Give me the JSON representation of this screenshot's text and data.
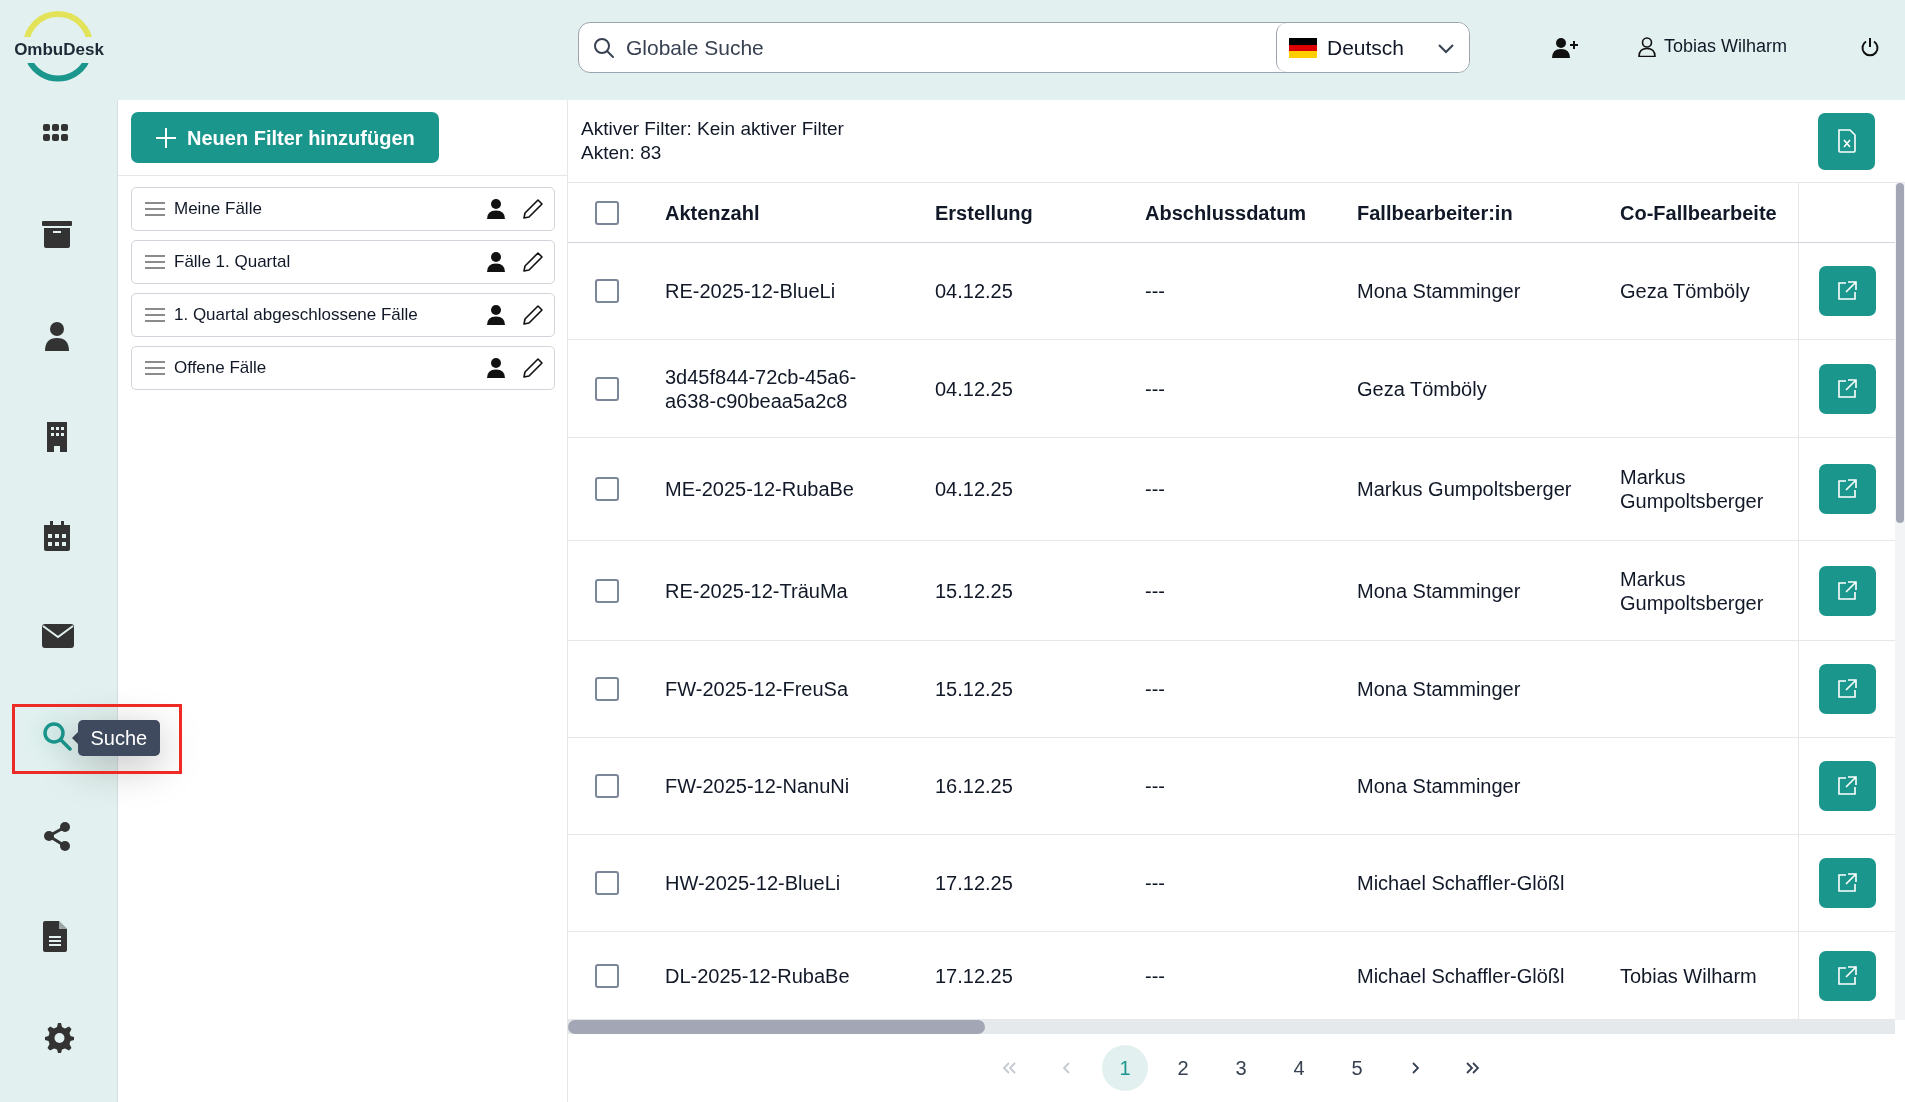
{
  "logo": {
    "text": "OmbuDesk"
  },
  "search": {
    "placeholder": "Globale Suche"
  },
  "language": {
    "label": "Deutsch"
  },
  "user": {
    "name": "Tobias Wilharm"
  },
  "nav": [
    {
      "kind": "apps",
      "selected": false,
      "highlighted": false
    },
    {
      "kind": "archive",
      "selected": false,
      "highlighted": false
    },
    {
      "kind": "person",
      "selected": false,
      "highlighted": false
    },
    {
      "kind": "building",
      "selected": false,
      "highlighted": false
    },
    {
      "kind": "calendar",
      "selected": false,
      "highlighted": false
    },
    {
      "kind": "mail",
      "selected": false,
      "highlighted": false
    },
    {
      "kind": "search",
      "selected": true,
      "highlighted": true,
      "tooltip": "Suche"
    },
    {
      "kind": "share",
      "selected": false,
      "highlighted": false
    },
    {
      "kind": "document",
      "selected": false,
      "highlighted": false
    },
    {
      "kind": "settings",
      "selected": false,
      "highlighted": false
    }
  ],
  "filter_panel": {
    "add_button": "Neuen Filter hinzufügen",
    "filters": [
      {
        "label": "Meine Fälle"
      },
      {
        "label": "Fälle 1. Quartal"
      },
      {
        "label": "1. Quartal abgeschlossene Fälle"
      },
      {
        "label": "Offene Fälle"
      }
    ]
  },
  "table_info": {
    "active_filter": "Aktiver Filter: Kein aktiver Filter",
    "count": "Akten: 83"
  },
  "table": {
    "select_all_checked": false,
    "columns": [
      "Aktenzahl",
      "Erstellung",
      "Abschlussdatum",
      "Fallbearbeiter:in",
      "Co-Fallbearbeite"
    ],
    "rows": [
      {
        "checked": false,
        "cells": [
          "RE-2025-12-BlueLi",
          "04.12.25",
          "---",
          "Mona Stamminger",
          "Geza Tömböly"
        ]
      },
      {
        "checked": false,
        "cells": [
          "3d45f844-72cb-45a6-a638-c90beaa5a2c8",
          "04.12.25",
          "---",
          "Geza Tömböly",
          ""
        ]
      },
      {
        "checked": false,
        "cells": [
          "ME-2025-12-RubaBe",
          "04.12.25",
          "---",
          "Markus Gumpoltsberger",
          "Markus Gumpoltsberger"
        ]
      },
      {
        "checked": false,
        "cells": [
          "RE-2025-12-TräuMa",
          "15.12.25",
          "---",
          "Mona Stamminger",
          "Markus Gumpoltsberger"
        ]
      },
      {
        "checked": false,
        "cells": [
          "FW-2025-12-FreuSa",
          "15.12.25",
          "---",
          "Mona Stamminger",
          ""
        ]
      },
      {
        "checked": false,
        "cells": [
          "FW-2025-12-NanuNi",
          "16.12.25",
          "---",
          "Mona Stamminger",
          ""
        ]
      },
      {
        "checked": false,
        "cells": [
          "HW-2025-12-BlueLi",
          "17.12.25",
          "---",
          "Michael Schaffler-Glößl",
          ""
        ]
      },
      {
        "checked": false,
        "cells": [
          "DL-2025-12-RubaBe",
          "17.12.25",
          "---",
          "Michael Schaffler-Glößl",
          "Tobias Wilharm"
        ]
      }
    ]
  },
  "pagination": {
    "first": {
      "disabled": true
    },
    "previous": {
      "disabled": true
    },
    "pages": [
      {
        "label": "1",
        "selected": true
      },
      {
        "label": "2",
        "selected": false
      },
      {
        "label": "3",
        "selected": false
      },
      {
        "label": "4",
        "selected": false
      },
      {
        "label": "5",
        "selected": false
      }
    ],
    "next": {
      "disabled": false
    },
    "last": {
      "disabled": false
    }
  }
}
